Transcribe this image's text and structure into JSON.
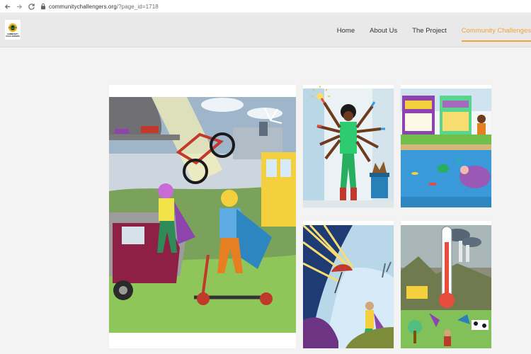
{
  "browser": {
    "url_domain": "communitychallengers.org",
    "url_path": "/?page_id=1718"
  },
  "site": {
    "logo_text": "COMMUNITY CHALLENGERS",
    "nav": [
      {
        "label": "Home",
        "active": false
      },
      {
        "label": "About Us",
        "active": false
      },
      {
        "label": "The Project",
        "active": false
      },
      {
        "label": "Community Challenges",
        "active": true
      }
    ],
    "accent_color": "#f0a43a"
  },
  "gallery": {
    "images": [
      {
        "name": "superheroes-bike-scooter-illustration",
        "icon": "illustration"
      },
      {
        "name": "multi-armed-hero-recycling-illustration",
        "icon": "illustration"
      },
      {
        "name": "market-and-ocean-cleanup-illustration",
        "icon": "illustration"
      },
      {
        "name": "hero-umbrella-sun-rays-illustration",
        "icon": "illustration"
      },
      {
        "name": "thermometer-pollution-illustration",
        "icon": "illustration"
      }
    ]
  }
}
